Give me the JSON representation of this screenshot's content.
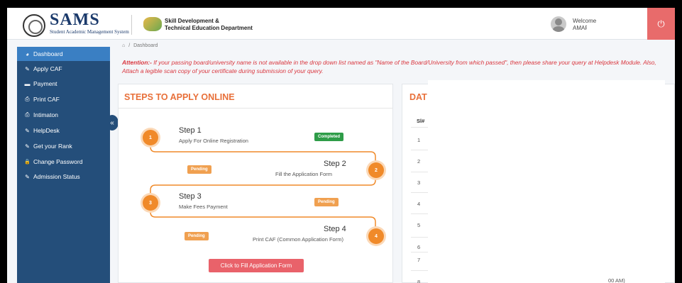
{
  "header": {
    "logo_title": "SAMS",
    "logo_subtitle": "Student Academic Management System",
    "dept_line1": "Skill Development &",
    "dept_line2": "Technical Education Department",
    "welcome": "Welcome",
    "user_name": "AMAR",
    "power_icon": "power-icon"
  },
  "sidebar": {
    "items": [
      {
        "label": "Dashboard",
        "icon": "dashboard-icon",
        "glyph": "◕"
      },
      {
        "label": "Apply CAF",
        "icon": "user-edit-icon",
        "glyph": "✎"
      },
      {
        "label": "Payment",
        "icon": "card-icon",
        "glyph": "▬"
      },
      {
        "label": "Print CAF",
        "icon": "print-icon",
        "glyph": "⎙"
      },
      {
        "label": "Intimaton",
        "icon": "print-icon",
        "glyph": "⎙"
      },
      {
        "label": "HelpDesk",
        "icon": "user-edit-icon",
        "glyph": "✎"
      },
      {
        "label": "Get your Rank",
        "icon": "user-edit-icon",
        "glyph": "✎"
      },
      {
        "label": "Change Password",
        "icon": "lock-icon",
        "glyph": "🔒"
      },
      {
        "label": "Admission Status",
        "icon": "user-edit-icon",
        "glyph": "✎"
      }
    ],
    "collapse_glyph": "«"
  },
  "breadcrumb": {
    "home_glyph": "⌂",
    "separator": "/",
    "current": "Dashboard"
  },
  "attention": {
    "label": "Attention:-",
    "text": " If your passing board/university name is not available in the drop down list named as \"Name of the Board/University from which passed\", then please share your query at Helpdesk Module. Also, Attach a legible scan copy of your certificate during submission of your query."
  },
  "steps_panel": {
    "title": "STEPS TO APPLY ONLINE",
    "steps": [
      {
        "number": "1",
        "title": "Step 1",
        "desc": "Apply For Online Registration",
        "status": "Completed"
      },
      {
        "number": "2",
        "title": "Step 2",
        "desc": "Fill the Application Form",
        "status": "Pending"
      },
      {
        "number": "3",
        "title": "Step 3",
        "desc": "Make Fees Payment",
        "status": "Pending"
      },
      {
        "number": "4",
        "title": "Step 4",
        "desc": "Print CAF (Common Application Form)",
        "status": "Pending"
      }
    ],
    "button": "Click to Fill Application Form"
  },
  "dates_panel": {
    "title": "DAT",
    "column_sl": "Sl#",
    "rows": [
      "1",
      "2",
      "3",
      "4",
      "5",
      "6",
      "7",
      "8"
    ],
    "time_fragment": "00 AM)"
  }
}
